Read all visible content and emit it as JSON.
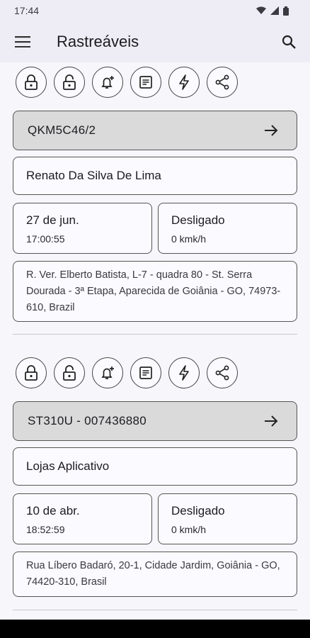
{
  "status": {
    "time": "17:44"
  },
  "appbar": {
    "title": "Rastreáveis"
  },
  "trackers": [
    {
      "id": "QKM5C46/2",
      "name": "Renato Da Silva De Lima",
      "date": "27 de jun.",
      "time": "17:00:55",
      "state": "Desligado",
      "speed": "0 kmk/h",
      "address": "R. Ver. Elberto Batista, L-7 - quadra 80 - St. Serra Dourada - 3ª Etapa, Aparecida de Goiânia - GO, 74973-610, Brazil"
    },
    {
      "id": "ST310U - 007436880",
      "name": "Lojas Aplicativo",
      "date": "10 de abr.",
      "time": "18:52:59",
      "state": "Desligado",
      "speed": "0 kmk/h",
      "address": "Rua Líbero Badaró, 20-1, Cidade Jardim, Goiânia - GO, 74420-310, Brasil"
    }
  ],
  "action_icons": [
    "lock-icon",
    "unlock-icon",
    "add-alert-icon",
    "report-icon",
    "power-icon",
    "share-icon"
  ]
}
